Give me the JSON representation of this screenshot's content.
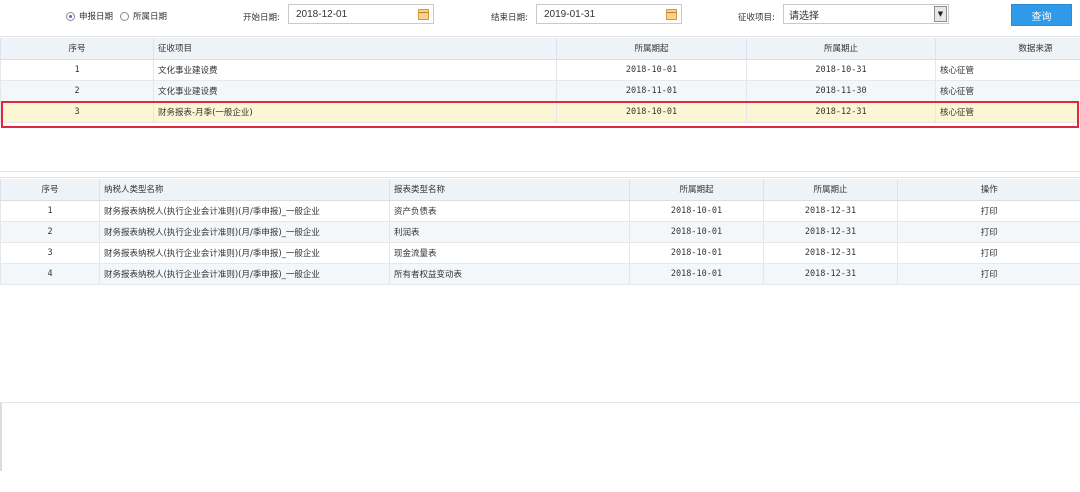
{
  "search": {
    "radio_declare": "申报日期",
    "radio_period": "所属日期",
    "start_label": "开始日期:",
    "start_value": "2018-12-01",
    "end_label": "结束日期:",
    "end_value": "2019-01-31",
    "item_label": "征收项目:",
    "item_value": "请选择",
    "query_button": "查询"
  },
  "table1": {
    "headers": [
      "序号",
      "征收项目",
      "所属期起",
      "所属期止",
      "数据来源"
    ],
    "rows": [
      {
        "no": "1",
        "item": "文化事业建设费",
        "start": "2018-10-01",
        "end": "2018-10-31",
        "source": "核心征管"
      },
      {
        "no": "2",
        "item": "文化事业建设费",
        "start": "2018-11-01",
        "end": "2018-11-30",
        "source": "核心征管"
      },
      {
        "no": "3",
        "item": "财务报表-月季(一般企业)",
        "start": "2018-10-01",
        "end": "2018-12-31",
        "source": "核心征管"
      }
    ]
  },
  "table2": {
    "headers": [
      "序号",
      "纳税人类型名称",
      "报表类型名称",
      "所属期起",
      "所属期止",
      "操作"
    ],
    "rows": [
      {
        "no": "1",
        "type": "财务报表纳税人(执行企业会计准则)(月/季申报)_一般企业",
        "report": "资产负债表",
        "start": "2018-10-01",
        "end": "2018-12-31",
        "op": "打印"
      },
      {
        "no": "2",
        "type": "财务报表纳税人(执行企业会计准则)(月/季申报)_一般企业",
        "report": "利润表",
        "start": "2018-10-01",
        "end": "2018-12-31",
        "op": "打印"
      },
      {
        "no": "3",
        "type": "财务报表纳税人(执行企业会计准则)(月/季申报)_一般企业",
        "report": "现金流量表",
        "start": "2018-10-01",
        "end": "2018-12-31",
        "op": "打印"
      },
      {
        "no": "4",
        "type": "财务报表纳税人(执行企业会计准则)(月/季申报)_一般企业",
        "report": "所有者权益变动表",
        "start": "2018-10-01",
        "end": "2018-12-31",
        "op": "打印"
      }
    ]
  },
  "colors": {
    "query_button": "#2f9be8",
    "selected_row": "#fdf6d4",
    "selected_outline": "#e0283c",
    "header_bg": "#eef3f8"
  }
}
